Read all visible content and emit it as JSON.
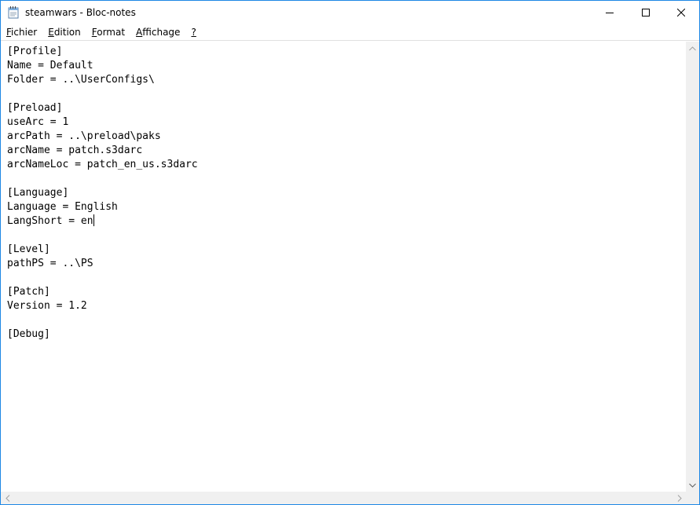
{
  "window": {
    "title": "steamwars - Bloc-notes",
    "icon": "notepad-icon"
  },
  "caption_buttons": {
    "minimize": "minimize-icon",
    "maximize": "maximize-icon",
    "close": "close-icon"
  },
  "menu": {
    "items": [
      {
        "accel": "F",
        "rest": "ichier"
      },
      {
        "accel": "E",
        "rest": "dition"
      },
      {
        "accel": "F",
        "rest": "ormat"
      },
      {
        "accel": "A",
        "rest": "ffichage"
      },
      {
        "accel": "?",
        "rest": ""
      }
    ]
  },
  "editor": {
    "lines": [
      "[Profile]",
      "Name = Default",
      "Folder = ..\\UserConfigs\\",
      "",
      "[Preload]",
      "useArc = 1",
      "arcPath = ..\\preload\\paks",
      "arcName = patch.s3darc",
      "arcNameLoc = patch_en_us.s3darc",
      "",
      "[Language]",
      "Language = English",
      "LangShort = en",
      "",
      "[Level]",
      "pathPS = ..\\PS",
      "",
      "[Patch]",
      "Version = 1.2",
      "",
      "[Debug]"
    ],
    "caret_line": 12
  }
}
